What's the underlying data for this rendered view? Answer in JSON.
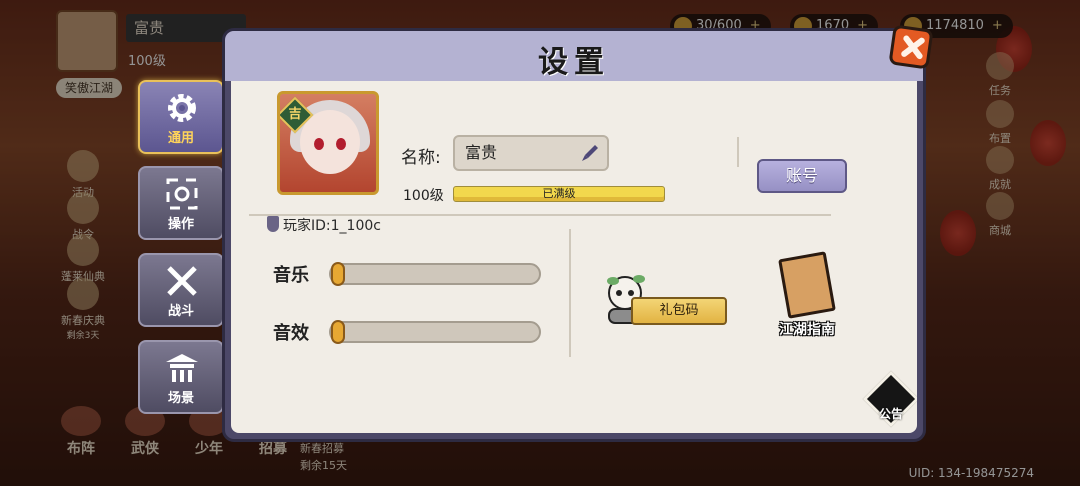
{
  "hud": {
    "player_name": "富贵",
    "level": "100级",
    "guild": "笑傲江湖",
    "resources": [
      {
        "icon": "stamina-icon",
        "value": "30/600"
      },
      {
        "icon": "gold-ingot-icon",
        "value": "1670"
      },
      {
        "icon": "coin-icon",
        "value": "1174810"
      }
    ]
  },
  "background_side": [
    "活动",
    "战令",
    "蓬莱仙典",
    "新春庆典"
  ],
  "background_side_sub": "剩余3天",
  "background_right": [
    "任务",
    "布置",
    "成就",
    "商城"
  ],
  "bottom_nav": [
    "布阵",
    "武侠",
    "少年",
    "招募"
  ],
  "recruit_event": {
    "title": "新春招募",
    "remaining": "剩余15天"
  },
  "uid": "UID: 134-198475274",
  "tabs": [
    {
      "label": "通用",
      "icon": "gear-icon",
      "active": true
    },
    {
      "label": "操作",
      "icon": "crosshair-icon",
      "active": false
    },
    {
      "label": "战斗",
      "icon": "crossed-swords-icon",
      "active": false
    },
    {
      "label": "场景",
      "icon": "pavilion-icon",
      "active": false
    }
  ],
  "settings": {
    "title": "设置",
    "name_label": "名称:",
    "name_value": "富贵",
    "level_label": "100级",
    "level_status": "已满级",
    "player_id": "玩家ID:1_100c",
    "account_button": "账号",
    "music_label": "音乐",
    "sound_label": "音效",
    "music_volume": 0,
    "sound_volume": 0,
    "gift_code_button": "礼包码",
    "guide_label": "江湖指南",
    "notice_label": "公告"
  },
  "colors": {
    "accent": "#e9c15a",
    "modal_header": "#b4b2d2",
    "panel": "#f1ede6",
    "close": "#e35a23"
  }
}
